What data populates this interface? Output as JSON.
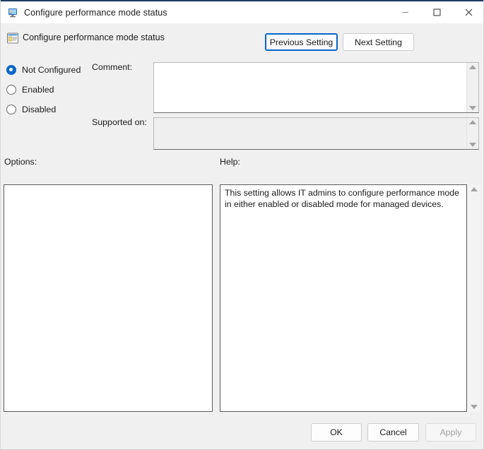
{
  "window": {
    "title": "Configure performance mode status",
    "title_icon": "computer-user-monitor-icon",
    "controls": {
      "minimize": "minimize-icon",
      "maximize": "maximize-icon",
      "close": "close-icon"
    },
    "accent_color": "#0b66c9",
    "titlebar_top_stripe": "#1d3a63",
    "background": "#f0f0f0"
  },
  "header": {
    "icon": "group-policy-setting-icon",
    "title": "Configure performance mode status",
    "previous_setting_label": "Previous Setting",
    "next_setting_label": "Next Setting",
    "previous_setting_focused": true
  },
  "state_options": {
    "selected": "Not Configured",
    "items": [
      {
        "label": "Not Configured",
        "selected": true
      },
      {
        "label": "Enabled",
        "selected": false
      },
      {
        "label": "Disabled",
        "selected": false
      }
    ]
  },
  "comment": {
    "label": "Comment:",
    "value": "",
    "placeholder": "",
    "editable": true
  },
  "supported_on": {
    "label": "Supported on:",
    "value": "",
    "editable": false
  },
  "options": {
    "label": "Options:",
    "content": ""
  },
  "help": {
    "label": "Help:",
    "text": "This setting allows IT admins to configure performance mode in either enabled or disabled mode for managed devices."
  },
  "footer": {
    "ok_label": "OK",
    "cancel_label": "Cancel",
    "apply_label": "Apply",
    "apply_enabled": false
  }
}
